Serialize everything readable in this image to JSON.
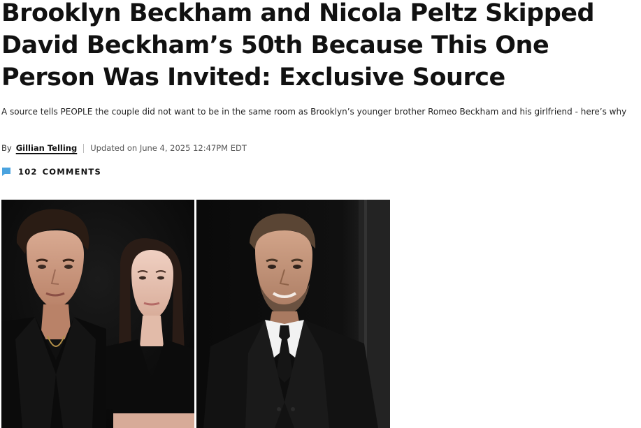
{
  "article": {
    "headline": "Brooklyn Beckham and Nicola Peltz Skipped David Beckham’s 50th Because This One Person Was Invited: Exclusive Source",
    "dek": "A source tells PEOPLE the couple did not want to be in the same room as Brooklyn’s younger brother Romeo Beckham and his girlfriend - here’s why",
    "byline": {
      "by_label": "By",
      "author": "Gillian Telling",
      "updated": "Updated on June 4, 2025 12:47PM EDT"
    },
    "comments": {
      "count": "102",
      "label": "COMMENTS",
      "icon": "comment-bubble-icon"
    },
    "images": [
      {
        "name": "couple-photo",
        "depicts": "man and woman in black outfits"
      },
      {
        "name": "portrait-photo",
        "depicts": "man in black suit and tie"
      }
    ]
  },
  "colors": {
    "text": "#111111",
    "accent_comment_icon": "#4aa3df",
    "photo_background": "#0d0d0d"
  }
}
